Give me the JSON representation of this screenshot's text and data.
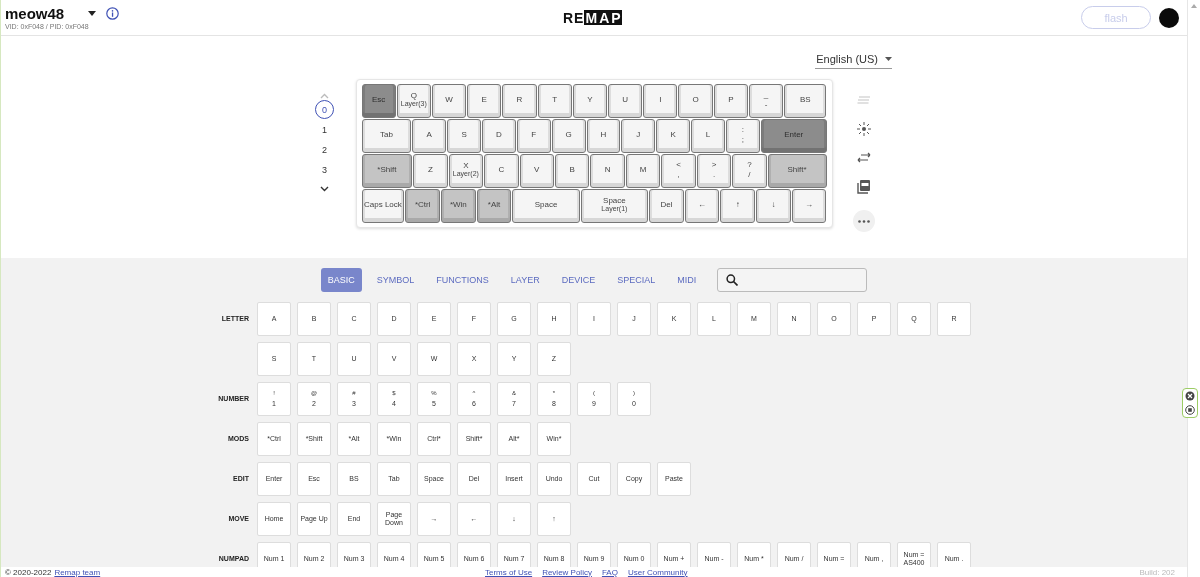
{
  "header": {
    "device_name": "meow48",
    "device_ids": "VID: 0xF048 / PID: 0xF048",
    "logo": {
      "plain": "RE",
      "boxed": "MAP"
    },
    "flash_button": {
      "label": "flash",
      "disabled": true
    }
  },
  "language": "English (US)",
  "layers": [
    {
      "label": "0",
      "selected": true
    },
    {
      "label": "1",
      "selected": false
    },
    {
      "label": "2",
      "selected": false
    },
    {
      "label": "3",
      "selected": false
    }
  ],
  "keyboard": {
    "rows": [
      {
        "keys": [
          {
            "label": "Esc",
            "kind": "dark"
          },
          {
            "label": "Q",
            "sub": "Layer(3)",
            "kind": "normal"
          },
          {
            "label": "W",
            "kind": "normal"
          },
          {
            "label": "E",
            "kind": "normal"
          },
          {
            "label": "R",
            "kind": "normal"
          },
          {
            "label": "T",
            "kind": "normal"
          },
          {
            "label": "Y",
            "kind": "normal"
          },
          {
            "label": "U",
            "kind": "normal"
          },
          {
            "label": "I",
            "kind": "normal"
          },
          {
            "label": "O",
            "kind": "normal"
          },
          {
            "label": "P",
            "kind": "normal"
          },
          {
            "label": "-",
            "shifted": "_",
            "kind": "normal"
          },
          {
            "label": "BS",
            "kind": "normal"
          }
        ]
      },
      {
        "keys": [
          {
            "label": "Tab",
            "kind": "normal"
          },
          {
            "label": "A",
            "kind": "normal"
          },
          {
            "label": "S",
            "kind": "normal"
          },
          {
            "label": "D",
            "kind": "normal"
          },
          {
            "label": "F",
            "kind": "normal"
          },
          {
            "label": "G",
            "kind": "normal"
          },
          {
            "label": "H",
            "kind": "normal"
          },
          {
            "label": "J",
            "kind": "normal"
          },
          {
            "label": "K",
            "kind": "normal"
          },
          {
            "label": "L",
            "kind": "normal"
          },
          {
            "label": ";",
            "shifted": ":",
            "kind": "normal"
          },
          {
            "label": "Enter",
            "kind": "dark"
          }
        ]
      },
      {
        "keys": [
          {
            "label": "*Shift",
            "kind": "modifier"
          },
          {
            "label": "Z",
            "kind": "normal"
          },
          {
            "label": "X",
            "sub": "Layer(2)",
            "kind": "normal"
          },
          {
            "label": "C",
            "kind": "normal"
          },
          {
            "label": "V",
            "kind": "normal"
          },
          {
            "label": "B",
            "kind": "normal"
          },
          {
            "label": "N",
            "kind": "normal"
          },
          {
            "label": "M",
            "kind": "normal"
          },
          {
            "label": ",",
            "shifted": "<",
            "kind": "normal"
          },
          {
            "label": ".",
            "shifted": ">",
            "kind": "normal"
          },
          {
            "label": "/",
            "shifted": "?",
            "kind": "normal"
          },
          {
            "label": "Shift*",
            "kind": "modifier"
          }
        ]
      },
      {
        "keys": [
          {
            "label": "Caps Lock",
            "kind": "normal"
          },
          {
            "label": "*Ctrl",
            "kind": "modifier"
          },
          {
            "label": "*Win",
            "kind": "modifier"
          },
          {
            "label": "*Alt",
            "kind": "modifier"
          },
          {
            "label": "Space",
            "kind": "normal"
          },
          {
            "label": "Space",
            "sub": "Layer(1)",
            "kind": "normal"
          },
          {
            "label": "Del",
            "kind": "normal"
          },
          {
            "label": "←",
            "kind": "normal"
          },
          {
            "label": "↑",
            "kind": "normal"
          },
          {
            "label": "↓",
            "kind": "normal"
          },
          {
            "label": "→",
            "kind": "normal"
          }
        ]
      }
    ]
  },
  "tools": [
    {
      "kind": "notes",
      "disabled": true
    },
    {
      "kind": "light",
      "disabled": false
    },
    {
      "kind": "swap",
      "disabled": false
    },
    {
      "kind": "pdf",
      "disabled": false
    },
    {
      "kind": "more",
      "disabled": false
    }
  ],
  "keycode_tabs": [
    {
      "label": "BASIC",
      "selected": true
    },
    {
      "label": "SYMBOL",
      "selected": false
    },
    {
      "label": "FUNCTIONS",
      "selected": false
    },
    {
      "label": "LAYER",
      "selected": false
    },
    {
      "label": "DEVICE",
      "selected": false
    },
    {
      "label": "SPECIAL",
      "selected": false
    },
    {
      "label": "MIDI",
      "selected": false
    }
  ],
  "categories": [
    {
      "name": "LETTER",
      "keys": [
        {
          "label": "A"
        },
        {
          "label": "B"
        },
        {
          "label": "C"
        },
        {
          "label": "D"
        },
        {
          "label": "E"
        },
        {
          "label": "F"
        },
        {
          "label": "G"
        },
        {
          "label": "H"
        },
        {
          "label": "I"
        },
        {
          "label": "J"
        },
        {
          "label": "K"
        },
        {
          "label": "L"
        },
        {
          "label": "M"
        },
        {
          "label": "N"
        },
        {
          "label": "O"
        },
        {
          "label": "P"
        },
        {
          "label": "Q"
        },
        {
          "label": "R"
        },
        {
          "label": "S"
        },
        {
          "label": "T"
        },
        {
          "label": "U"
        },
        {
          "label": "V"
        },
        {
          "label": "W"
        },
        {
          "label": "X"
        },
        {
          "label": "Y"
        },
        {
          "label": "Z"
        }
      ]
    },
    {
      "name": "NUMBER",
      "keys": [
        {
          "label": "1",
          "shifted": "!"
        },
        {
          "label": "2",
          "shifted": "@"
        },
        {
          "label": "3",
          "shifted": "#"
        },
        {
          "label": "4",
          "shifted": "$"
        },
        {
          "label": "5",
          "shifted": "%"
        },
        {
          "label": "6",
          "shifted": "^"
        },
        {
          "label": "7",
          "shifted": "&"
        },
        {
          "label": "8",
          "shifted": "*"
        },
        {
          "label": "9",
          "shifted": "("
        },
        {
          "label": "0",
          "shifted": ")"
        }
      ]
    },
    {
      "name": "MODS",
      "keys": [
        {
          "label": "*Ctrl"
        },
        {
          "label": "*Shift"
        },
        {
          "label": "*Alt"
        },
        {
          "label": "*Win"
        },
        {
          "label": "Ctrl*"
        },
        {
          "label": "Shift*"
        },
        {
          "label": "Alt*"
        },
        {
          "label": "Win*"
        }
      ]
    },
    {
      "name": "EDIT",
      "keys": [
        {
          "label": "Enter"
        },
        {
          "label": "Esc"
        },
        {
          "label": "BS"
        },
        {
          "label": "Tab"
        },
        {
          "label": "Space"
        },
        {
          "label": "Del"
        },
        {
          "label": "Insert"
        },
        {
          "label": "Undo"
        },
        {
          "label": "Cut"
        },
        {
          "label": "Copy"
        },
        {
          "label": "Paste"
        }
      ]
    },
    {
      "name": "MOVE",
      "keys": [
        {
          "label": "Home"
        },
        {
          "label": "Page Up"
        },
        {
          "label": "End"
        },
        {
          "label": "Page Down"
        },
        {
          "label": "→"
        },
        {
          "label": "←"
        },
        {
          "label": "↓"
        },
        {
          "label": "↑"
        }
      ]
    },
    {
      "name": "NUMPAD",
      "keys": [
        {
          "label": "Num 1"
        },
        {
          "label": "Num 2"
        },
        {
          "label": "Num 3"
        },
        {
          "label": "Num 4"
        },
        {
          "label": "Num 5"
        },
        {
          "label": "Num 6"
        },
        {
          "label": "Num 7"
        },
        {
          "label": "Num 8"
        },
        {
          "label": "Num 9"
        },
        {
          "label": "Num 0"
        },
        {
          "label": "Num +"
        },
        {
          "label": "Num -"
        },
        {
          "label": "Num *"
        },
        {
          "label": "Num /"
        },
        {
          "label": "Num ="
        },
        {
          "label": "Num ,"
        },
        {
          "label": "Num = AS400"
        },
        {
          "label": "Num ."
        }
      ]
    }
  ],
  "footer": {
    "copyright": "© 2020-2022",
    "team_link": "Remap team",
    "links": [
      "Terms of Use",
      "Review Policy",
      "FAQ",
      "User Community"
    ],
    "build": "Build: 202"
  }
}
